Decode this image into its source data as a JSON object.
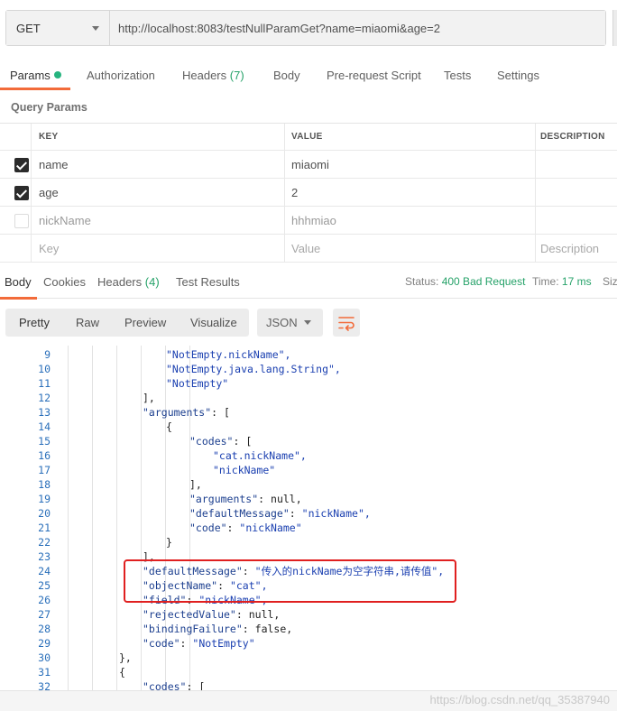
{
  "request": {
    "method": "GET",
    "url": "http://localhost:8083/testNullParamGet?name=miaomi&age=2"
  },
  "request_tabs": [
    {
      "label": "Params",
      "active": true,
      "dot": true
    },
    {
      "label": "Authorization"
    },
    {
      "label": "Headers",
      "count": "(7)"
    },
    {
      "label": "Body"
    },
    {
      "label": "Pre-request Script"
    },
    {
      "label": "Tests"
    },
    {
      "label": "Settings"
    }
  ],
  "query_params": {
    "title": "Query Params",
    "headers": [
      "KEY",
      "VALUE",
      "DESCRIPTION"
    ],
    "rows": [
      {
        "checked": true,
        "key": "name",
        "value": "miaomi",
        "description": ""
      },
      {
        "checked": true,
        "key": "age",
        "value": "2",
        "description": ""
      },
      {
        "checked": false,
        "key": "nickName",
        "value": "hhhmiao",
        "description": ""
      }
    ],
    "placeholders": {
      "key": "Key",
      "value": "Value",
      "description": "Description"
    }
  },
  "response_tabs": [
    {
      "label": "Body",
      "active": true
    },
    {
      "label": "Cookies"
    },
    {
      "label": "Headers",
      "count": "(4)"
    },
    {
      "label": "Test Results"
    }
  ],
  "response_status": {
    "status_label": "Status:",
    "status_value": "400 Bad Request",
    "time_label": "Time:",
    "time_value": "17 ms",
    "size_label": "Size"
  },
  "body_toolbar": {
    "views": [
      "Pretty",
      "Raw",
      "Preview",
      "Visualize"
    ],
    "active_view": "Pretty",
    "format": "JSON",
    "wrap_icon": "wrap-lines-icon"
  },
  "code_lines": [
    {
      "n": "9",
      "text": "\"NotEmpty.nickName\","
    },
    {
      "n": "10",
      "text": "\"NotEmpty.java.lang.String\","
    },
    {
      "n": "11",
      "text": "\"NotEmpty\""
    },
    {
      "n": "12",
      "text": "],"
    },
    {
      "n": "13",
      "text": "\"arguments\": ["
    },
    {
      "n": "14",
      "text": "{"
    },
    {
      "n": "15",
      "text": "\"codes\": ["
    },
    {
      "n": "16",
      "text": "\"cat.nickName\","
    },
    {
      "n": "17",
      "text": "\"nickName\""
    },
    {
      "n": "18",
      "text": "],"
    },
    {
      "n": "19",
      "text": "\"arguments\": null,"
    },
    {
      "n": "20",
      "text": "\"defaultMessage\": \"nickName\","
    },
    {
      "n": "21",
      "text": "\"code\": \"nickName\""
    },
    {
      "n": "22",
      "text": "}"
    },
    {
      "n": "23",
      "text": "],"
    },
    {
      "n": "24",
      "text": "\"defaultMessage\": \"传入的nickName为空字符串,请传值\","
    },
    {
      "n": "25",
      "text": "\"objectName\": \"cat\","
    },
    {
      "n": "26",
      "text": "\"field\": \"nickName\","
    },
    {
      "n": "27",
      "text": "\"rejectedValue\": null,"
    },
    {
      "n": "28",
      "text": "\"bindingFailure\": false,"
    },
    {
      "n": "29",
      "text": "\"code\": \"NotEmpty\""
    },
    {
      "n": "30",
      "text": "},"
    },
    {
      "n": "31",
      "text": "{"
    },
    {
      "n": "32",
      "text": "\"codes\": ["
    }
  ],
  "watermark": "https://blog.csdn.net/qq_35387940"
}
